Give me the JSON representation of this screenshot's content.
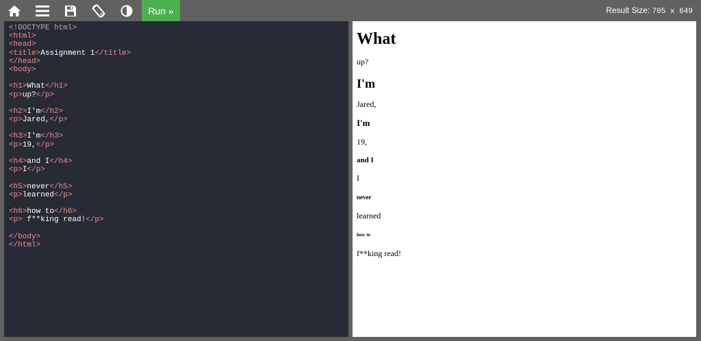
{
  "toolbar": {
    "icons": [
      "home-icon",
      "menu-icon",
      "save-icon",
      "rotate-icon",
      "contrast-icon"
    ],
    "run_label": "Run »",
    "result_size_label": "Result Size:",
    "result_size_value": "705 x 649",
    "accent_color": "#4caf50"
  },
  "editor": {
    "lines": [
      [
        {
          "t": "<!DOCTYPE html>",
          "c": "comment"
        }
      ],
      [
        {
          "t": "<html>",
          "c": "tag"
        }
      ],
      [
        {
          "t": "<head>",
          "c": "tag"
        }
      ],
      [
        {
          "t": "<title>",
          "c": "tag"
        },
        {
          "t": "Assignment 1",
          "c": "txt"
        },
        {
          "t": "</title>",
          "c": "tag"
        }
      ],
      [
        {
          "t": "</head>",
          "c": "tag"
        }
      ],
      [
        {
          "t": "<body>",
          "c": "tag"
        }
      ],
      [],
      [
        {
          "t": "<h1>",
          "c": "tag"
        },
        {
          "t": "What",
          "c": "txt"
        },
        {
          "t": "</h1>",
          "c": "tag"
        }
      ],
      [
        {
          "t": "<p>",
          "c": "tag"
        },
        {
          "t": "up?",
          "c": "txt"
        },
        {
          "t": "</p>",
          "c": "tag"
        }
      ],
      [],
      [
        {
          "t": "<h2>",
          "c": "tag"
        },
        {
          "t": "I'm",
          "c": "txt"
        },
        {
          "t": "</h2>",
          "c": "tag"
        }
      ],
      [
        {
          "t": "<p>",
          "c": "tag"
        },
        {
          "t": "Jared,",
          "c": "txt"
        },
        {
          "t": "</p>",
          "c": "tag"
        }
      ],
      [],
      [
        {
          "t": "<h3>",
          "c": "tag"
        },
        {
          "t": "I'm",
          "c": "txt"
        },
        {
          "t": "</h3>",
          "c": "tag"
        }
      ],
      [
        {
          "t": "<p>",
          "c": "tag"
        },
        {
          "t": "19,",
          "c": "txt"
        },
        {
          "t": "</p>",
          "c": "tag"
        }
      ],
      [],
      [
        {
          "t": "<h4>",
          "c": "tag"
        },
        {
          "t": "and I",
          "c": "txt"
        },
        {
          "t": "</h4>",
          "c": "tag"
        }
      ],
      [
        {
          "t": "<p>",
          "c": "tag"
        },
        {
          "t": "I",
          "c": "txt"
        },
        {
          "t": "</p>",
          "c": "tag"
        }
      ],
      [],
      [
        {
          "t": "<h5>",
          "c": "tag"
        },
        {
          "t": "never",
          "c": "txt"
        },
        {
          "t": "</h5>",
          "c": "tag"
        }
      ],
      [
        {
          "t": "<p>",
          "c": "tag"
        },
        {
          "t": "learned",
          "c": "txt"
        },
        {
          "t": "</p>",
          "c": "tag"
        }
      ],
      [],
      [
        {
          "t": "<h6>",
          "c": "tag"
        },
        {
          "t": "how to",
          "c": "txt"
        },
        {
          "t": "</h6>",
          "c": "tag"
        }
      ],
      [
        {
          "t": "<p>",
          "c": "tag"
        },
        {
          "t": " f**king read!",
          "c": "txt"
        },
        {
          "t": "</p>",
          "c": "tag"
        }
      ],
      [],
      [
        {
          "t": "</body>",
          "c": "tag"
        }
      ],
      [
        {
          "t": "</html>",
          "c": "tag"
        }
      ]
    ]
  },
  "result": {
    "h1": "What",
    "p1": "up?",
    "h2": "I'm",
    "p2": "Jared,",
    "h3": "I'm",
    "p3": "19,",
    "h4": "and I",
    "p4": "I",
    "h5": "never",
    "p5": "learned",
    "h6": "how to",
    "p6": "f**king read!"
  }
}
